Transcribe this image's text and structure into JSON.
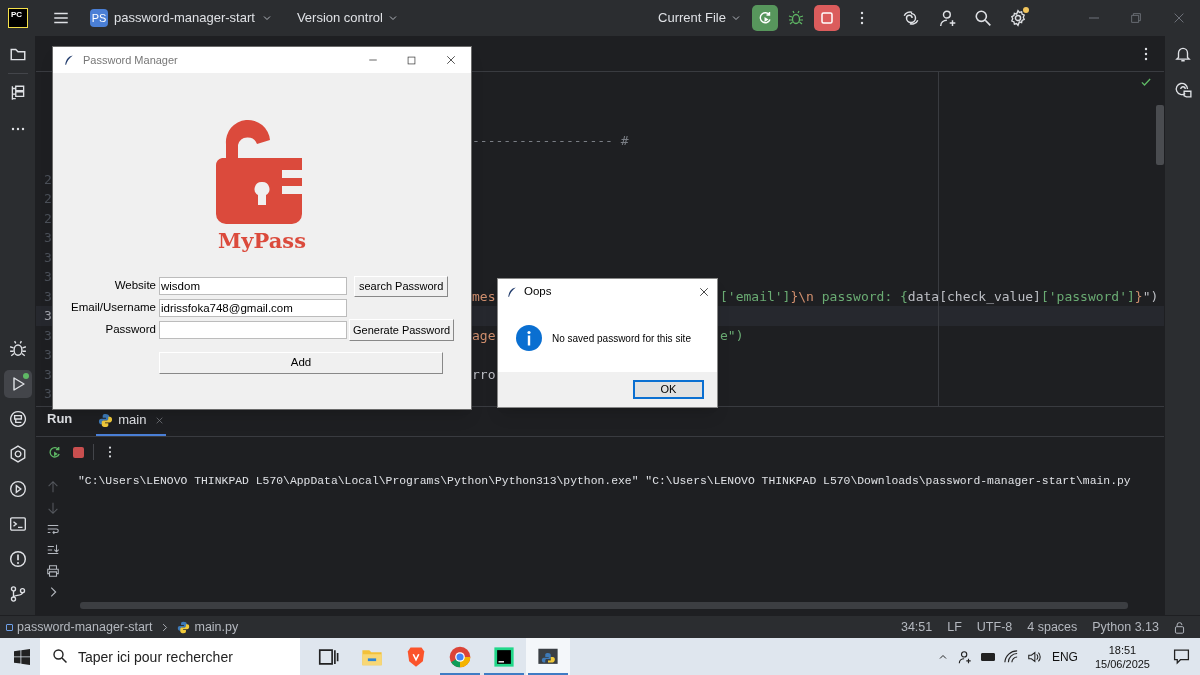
{
  "toolbar": {
    "logo": "PC",
    "project_badge": "PS",
    "project": "password-manager-start",
    "vcs": "Version control",
    "run_config": "Current File"
  },
  "editor": {
    "lines": [
      {
        "current": false
      },
      {
        "current": false
      },
      {
        "current": false
      },
      {
        "current": false,
        "left": [
          {
            "text": "------------------ #",
            "color": "#7a7e85"
          }
        ]
      },
      {
        "current": false
      },
      {
        "number": "2",
        "current": false
      },
      {
        "number": "2",
        "current": false
      },
      {
        "number": "2",
        "current": false
      },
      {
        "number": "3",
        "current": false
      },
      {
        "number": "3",
        "current": false
      },
      {
        "number": "3",
        "current": false
      },
      {
        "number": "3",
        "current": false,
        "left": [
          {
            "text": "mes",
            "color": "#cf8e6d"
          }
        ],
        "right": [
          {
            "text": "['email']",
            "color": "#6aab73"
          },
          {
            "text": "}\\n",
            "color": "#cf8e6d"
          },
          {
            "text": " password: {",
            "color": "#6aab73"
          },
          {
            "text": "data[check_value]",
            "color": "#bcbec4"
          },
          {
            "text": "['password']",
            "color": "#6aab73"
          },
          {
            "text": "}",
            "color": "#cf8e6d"
          },
          {
            "text": "\")",
            "color": "#bcbec4"
          }
        ]
      },
      {
        "number": "3",
        "current": true
      },
      {
        "number": "3",
        "current": false,
        "left": [
          {
            "text": "age",
            "color": "#cf8e6d"
          }
        ],
        "right": [
          {
            "text": "e\")",
            "color": "#6aab73"
          }
        ]
      },
      {
        "number": "3",
        "current": false
      },
      {
        "number": "3",
        "current": false,
        "left": [
          {
            "text": "rro",
            "color": "#bcbec4"
          }
        ]
      },
      {
        "number": "3",
        "current": false
      }
    ]
  },
  "run_panel": {
    "title": "Run",
    "tabs": [
      {
        "label": "main",
        "selected": true
      }
    ],
    "console": [
      "\"C:\\Users\\LENOVO THINKPAD L570\\AppData\\Local\\Programs\\Python\\Python313\\python.exe\" \"C:\\Users\\LENOVO THINKPAD L570\\Downloads\\password-manager-start\\main.py"
    ]
  },
  "status_bar": {
    "breadcrumbs": [
      "password-manager-start",
      "main.py"
    ],
    "items": [
      "34:51",
      "LF",
      "UTF-8",
      "4 spaces",
      "Python 3.13"
    ]
  },
  "password_manager": {
    "title": "Password Manager",
    "logo_text": "MyPass",
    "fields": [
      {
        "label": "Website",
        "value": "wisdom"
      },
      {
        "label": "Email/Username",
        "value": "idrissfoka748@gmail.com"
      },
      {
        "label": "Password"
      }
    ],
    "search_button": "search Password",
    "generate_button": "Generate Password",
    "add_button": "Add"
  },
  "dialog": {
    "title": "Oops",
    "message": "No saved password for this site",
    "button": "OK"
  },
  "taskbar": {
    "search_placeholder": "Taper ici pour rechercher",
    "apps": [
      {
        "kind": "taskview",
        "running": false,
        "selected": false
      },
      {
        "kind": "explorer",
        "running": false,
        "selected": false
      },
      {
        "kind": "brave",
        "running": false,
        "selected": false
      },
      {
        "kind": "chrome",
        "running": true,
        "selected": false
      },
      {
        "kind": "pycharm",
        "running": true,
        "selected": false
      },
      {
        "kind": "python",
        "running": true,
        "selected": true
      }
    ],
    "language": "ENG",
    "time": "18:51",
    "date": "15/06/2025"
  }
}
